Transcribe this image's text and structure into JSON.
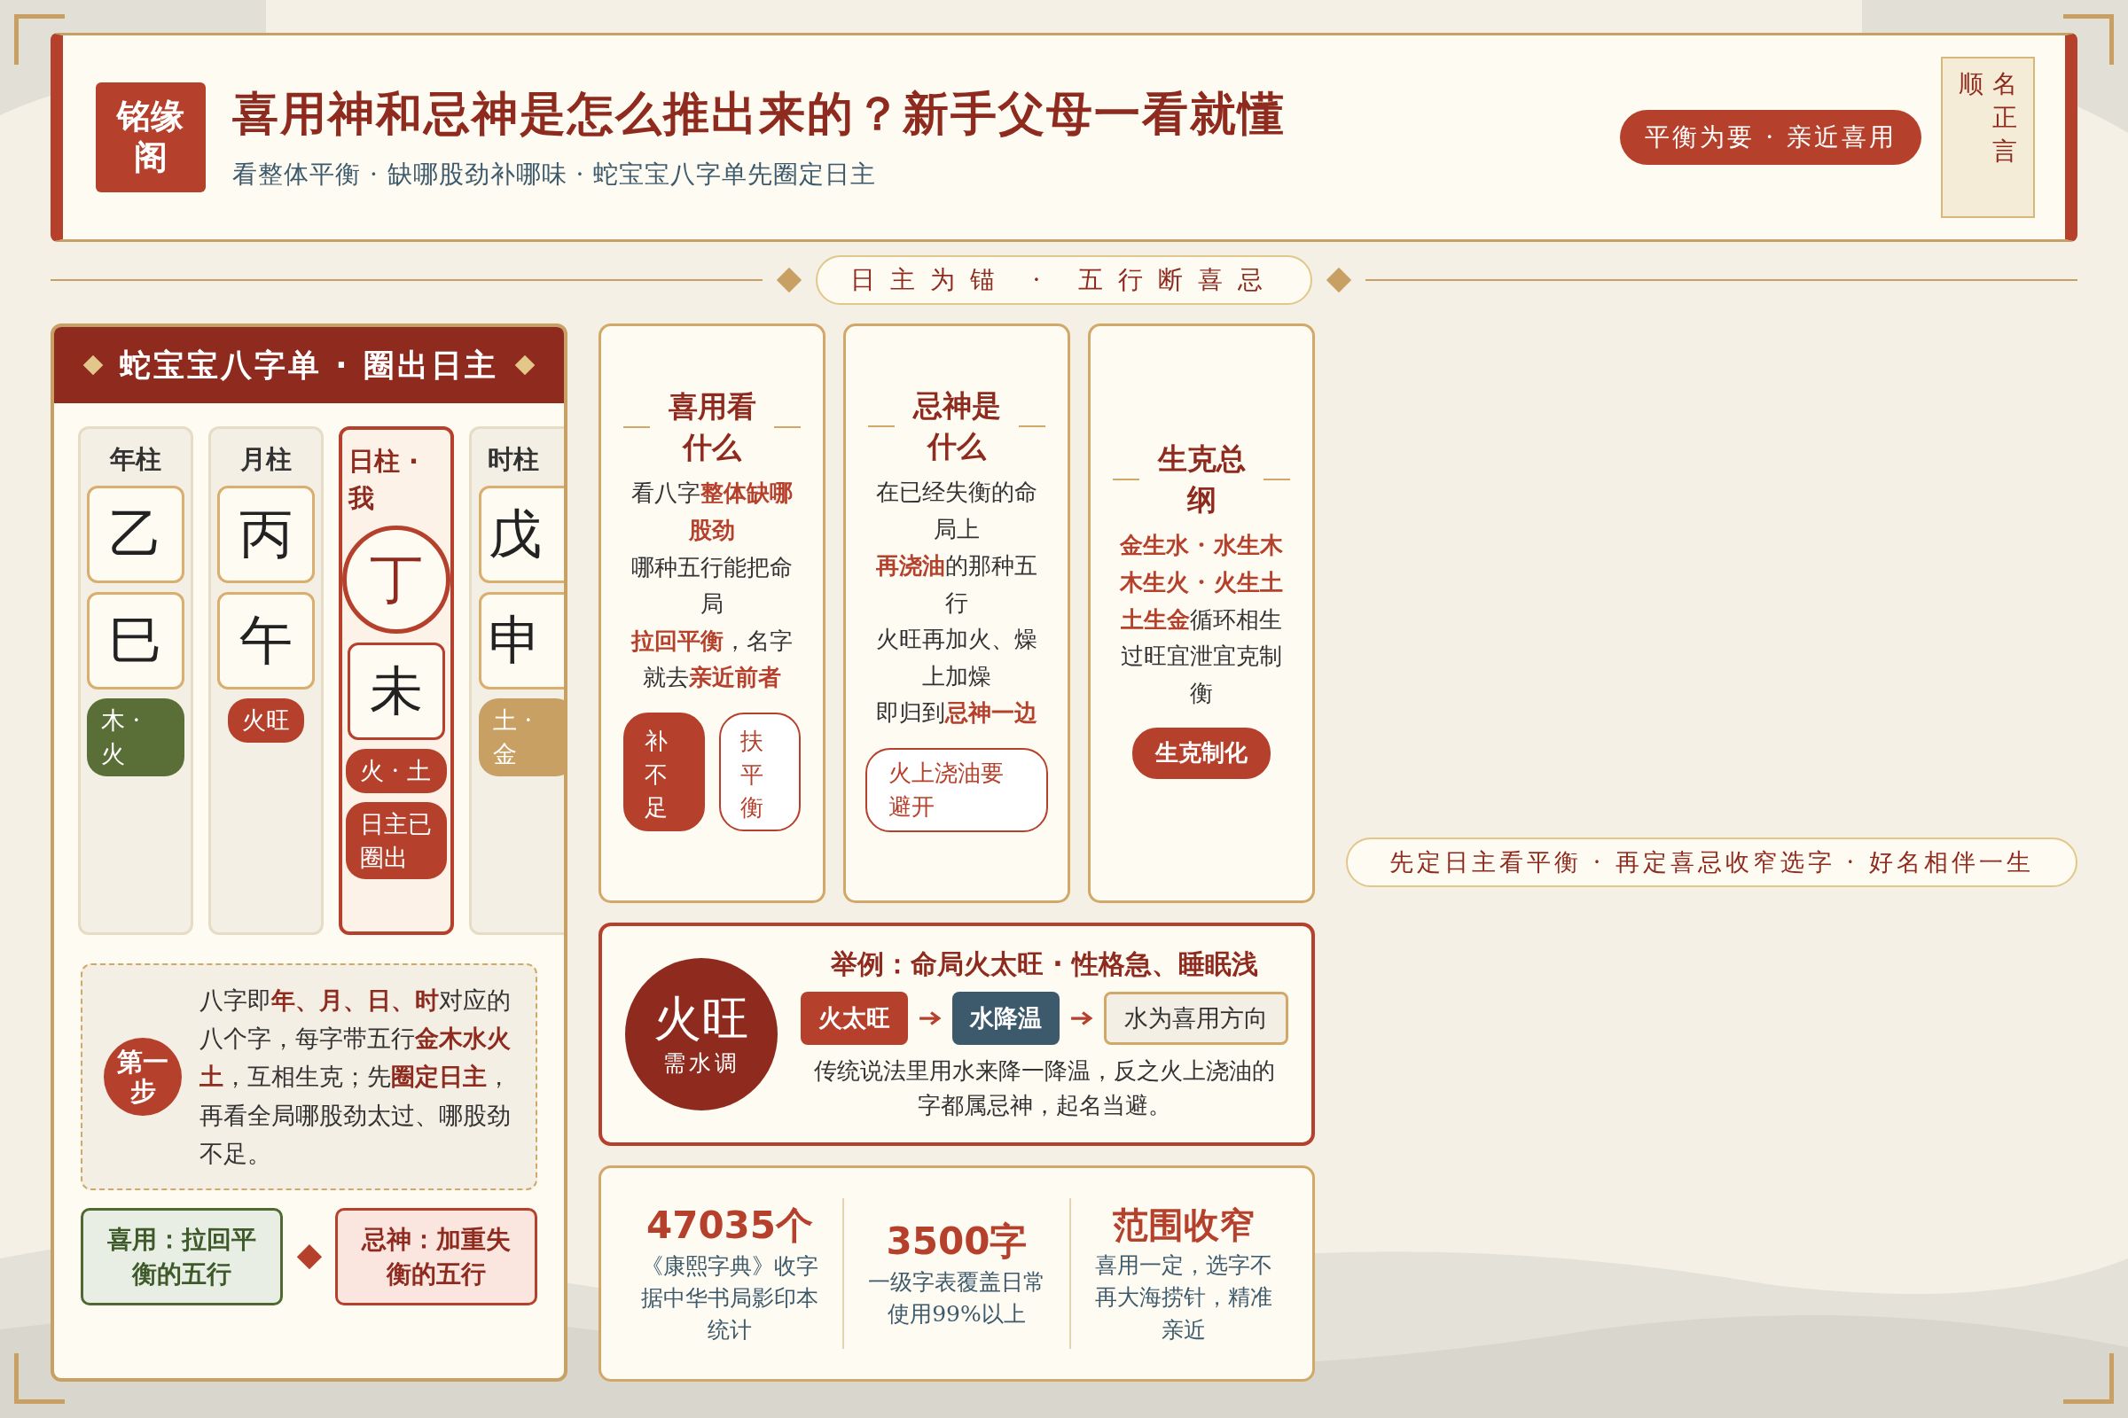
{
  "header": {
    "logo": "铭缘阁",
    "title": "喜用神和忌神是怎么推出来的？新手父母一看就懂",
    "subtitle": "看整体平衡 · 缺哪股劲补哪味 · 蛇宝宝八字单先圈定日主",
    "tag": "平衡为要 · 亲近喜用",
    "seal": [
      "顺",
      "名正言"
    ]
  },
  "banner": "日主为锚 · 五行断喜忌",
  "chart_panel": {
    "title": "蛇宝宝八字单 · 圈出日主",
    "pillars": [
      {
        "label": "年柱",
        "stem": "乙",
        "branch": "巳",
        "selected": false,
        "tags": [
          {
            "text": "木 · 火",
            "color": "#5a6e38"
          }
        ]
      },
      {
        "label": "月柱",
        "stem": "丙",
        "branch": "午",
        "selected": false,
        "tags": [
          {
            "text": "火旺",
            "color": "#b5402c"
          }
        ]
      },
      {
        "label": "日柱 · 我",
        "stem": "丁",
        "branch": "未",
        "selected": true,
        "tags": [
          {
            "text": "火 · 土",
            "color": "#b5402c"
          },
          {
            "text": "日主已圈出",
            "color": "#b5402c"
          }
        ]
      },
      {
        "label": "时柱",
        "stem": "戊",
        "branch": "申",
        "selected": false,
        "tags": [
          {
            "text": "土 · 金",
            "color": "#c9a063"
          }
        ]
      }
    ],
    "note": {
      "badge": "第一步",
      "text": "八字即**年、月、日、时**对应的八个字，每字带五行**金木水火土**，互相生克；先**圈定日主**，再看全局哪股劲太过、哪股劲不足。"
    },
    "contrast": [
      {
        "kind": "favor",
        "text": "喜用：拉回平衡的五行"
      },
      {
        "kind": "taboo",
        "text": "忌神：加重失衡的五行"
      }
    ]
  },
  "cards": [
    {
      "title": "喜用看什么",
      "lines": [
        "看八字**整体缺哪股劲**",
        "哪种五行能把命局",
        "**拉回平衡**，名字就去**亲近前者**"
      ],
      "chips": [
        {
          "kind": "filled",
          "text": "补不足"
        },
        {
          "kind": "outline",
          "text": "扶平衡"
        }
      ]
    },
    {
      "title": "忌神是什么",
      "lines": [
        "在已经失衡的命局上",
        "**再浇油**的那种五行",
        "火旺再加火、燥上加燥",
        "即归到**忌神一边**"
      ],
      "chips": [
        {
          "kind": "outline",
          "text": "火上浇油要避开"
        }
      ]
    },
    {
      "title": "生克总纲",
      "lines": [
        "**金生水 · 水生木**",
        "**木生火 · 火生土**",
        "**土生金**循环相生",
        "过旺宜泄宜克制衡"
      ],
      "chips": [
        {
          "kind": "filled",
          "text": "生克制化"
        }
      ]
    }
  ],
  "example": {
    "badge_main": "火旺",
    "badge_sub": "需水调",
    "title": "举例：命局火太旺 · 性格急、睡眠浅",
    "flow": [
      {
        "kind": "fire",
        "text": "火太旺"
      },
      {
        "kind": "water",
        "text": "水降温"
      },
      {
        "kind": "result",
        "text": "水为喜用方向"
      }
    ],
    "text": "传统说法里用水来降一降温，反之火上浇油的字都属忌神，起名当避。"
  },
  "stats": [
    {
      "kind": "number",
      "value": "47035个",
      "label": "《康熙字典》收字据中华书局影印本统计"
    },
    {
      "kind": "number",
      "value": "3500字",
      "label": "一级字表覆盖日常使用99%以上"
    },
    {
      "kind": "phrase",
      "value": "范围收窄",
      "label": "喜用一定，选字不再大海捞针，精准亲近"
    }
  ],
  "footer": "先定日主看平衡 · 再定喜忌收窄选字 · 好名相伴一生"
}
